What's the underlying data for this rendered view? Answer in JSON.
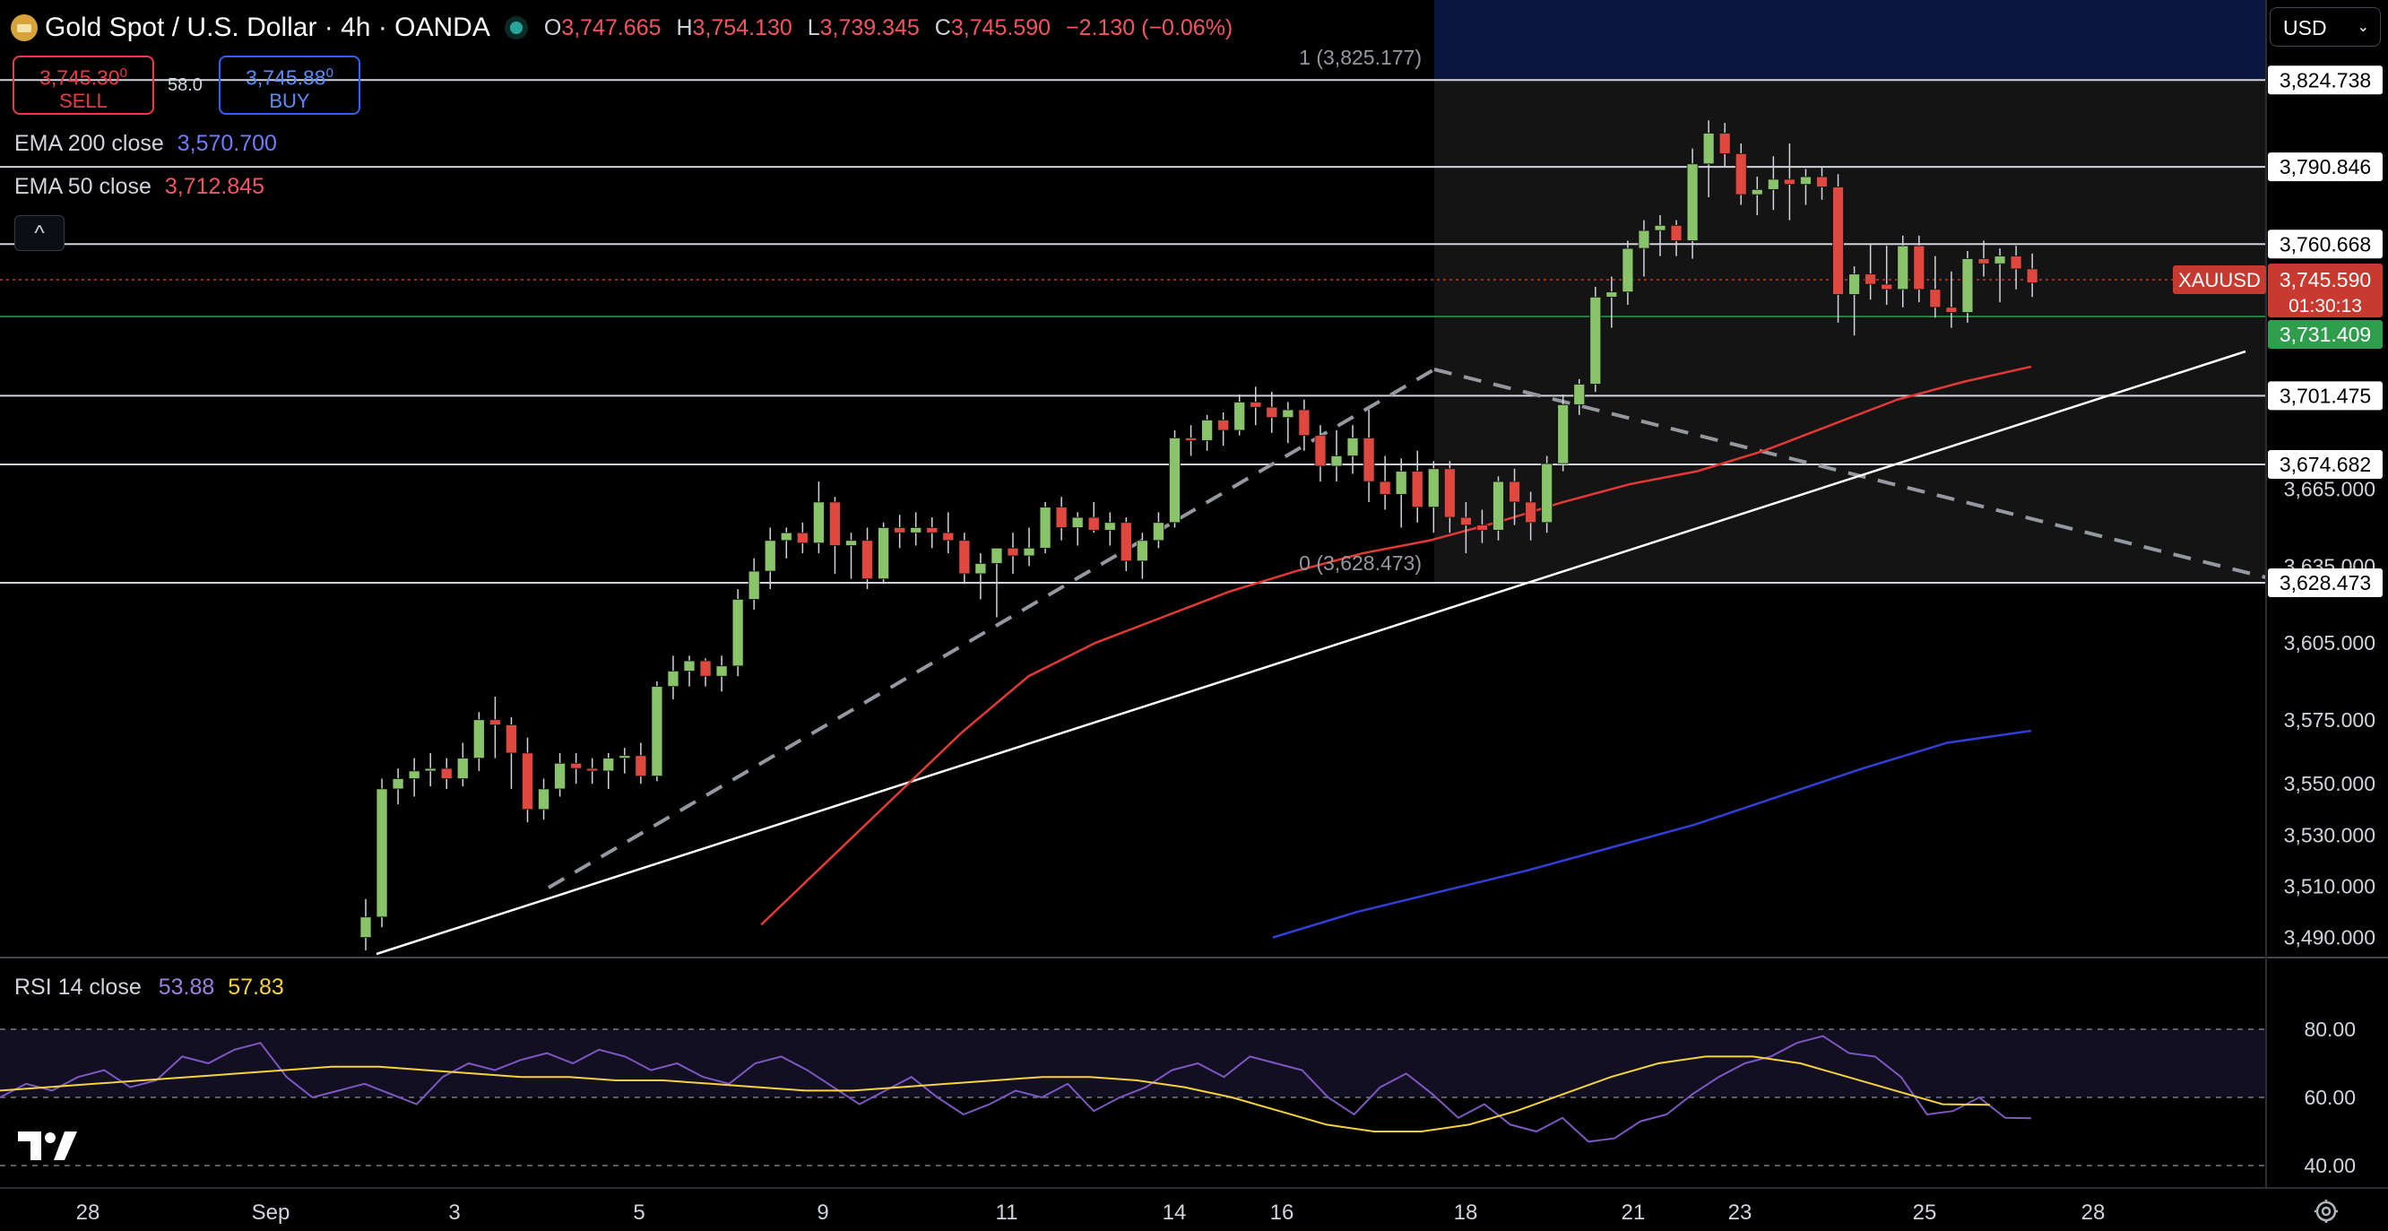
{
  "header": {
    "symbol_title": "Gold Spot / U.S. Dollar · 4h · OANDA",
    "ohlc": {
      "o_label": "O",
      "o": "3,747.665",
      "h_label": "H",
      "h": "3,754.130",
      "l_label": "L",
      "l": "3,739.345",
      "c_label": "C",
      "c": "3,745.590",
      "change": "−2.130 (−0.06%)"
    }
  },
  "trade": {
    "sell_price": "3,745.30",
    "sell_price_sup": "0",
    "sell_label": "SELL",
    "spread": "58.0",
    "buy_price": "3,745.88",
    "buy_price_sup": "0",
    "buy_label": "BUY"
  },
  "indicators": {
    "ema200_label": "EMA 200 close",
    "ema200_value": "3,570.700",
    "ema50_label": "EMA 50 close",
    "ema50_value": "3,712.845",
    "collapse_glyph": "^"
  },
  "currency_selector": {
    "value": "USD",
    "chevron": "⌄"
  },
  "fib": {
    "level_1": "1 (3,825.177)",
    "level_0": "0 (3,628.473)"
  },
  "price_axis": {
    "ticks": [
      "3,665.000",
      "3,635.000",
      "3,605.000",
      "3,575.000",
      "3,550.000",
      "3,530.000",
      "3,510.000",
      "3,490.000"
    ],
    "horizontal_levels": [
      "3,824.738",
      "3,790.846",
      "3,760.668",
      "3,701.475",
      "3,674.682",
      "3,628.473"
    ],
    "current_symbol": "XAUUSD",
    "current_price": "3,745.590",
    "countdown": "01:30:13",
    "green_level": "3,731.409"
  },
  "time_axis": {
    "labels": [
      "28",
      "Sep",
      "3",
      "5",
      "9",
      "11",
      "14",
      "16",
      "18",
      "21",
      "23",
      "25",
      "28"
    ]
  },
  "rsi": {
    "label": "RSI 14 close",
    "value": "53.88",
    "ma_value": "57.83",
    "ticks": [
      "80.00",
      "60.00",
      "40.00"
    ]
  },
  "colors": {
    "bull": "#89c36a",
    "bear": "#e0473e",
    "ema50": "#e53935",
    "ema200": "#3040d8",
    "rsi": "#7e57c2",
    "rsi_ma": "#f5d23e",
    "price_tag": "#c83a2f",
    "green_tag": "#2e9e4d",
    "fib_box": "#1c2a5e"
  },
  "icons": {
    "brand": "tradingview-logo-icon",
    "settings": "settings-gear-icon",
    "gold": "gold-spot-icon"
  },
  "chart_data": {
    "type": "candlestick",
    "symbol": "XAUUSD",
    "timeframe": "4h",
    "ylim": [
      3480,
      3845
    ],
    "indicators": [
      "EMA 200 close",
      "EMA 50 close",
      "RSI 14 close"
    ],
    "candles": [
      [
        3490,
        3505,
        3485,
        3498
      ],
      [
        3498,
        3552,
        3494,
        3548
      ],
      [
        3548,
        3556,
        3542,
        3552
      ],
      [
        3552,
        3560,
        3545,
        3555
      ],
      [
        3555,
        3562,
        3549,
        3556
      ],
      [
        3556,
        3560,
        3548,
        3552
      ],
      [
        3552,
        3566,
        3549,
        3560
      ],
      [
        3560,
        3578,
        3555,
        3575
      ],
      [
        3575,
        3584,
        3560,
        3573
      ],
      [
        3573,
        3576,
        3548,
        3562
      ],
      [
        3562,
        3568,
        3535,
        3540
      ],
      [
        3540,
        3552,
        3536,
        3548
      ],
      [
        3548,
        3562,
        3545,
        3558
      ],
      [
        3558,
        3562,
        3550,
        3556
      ],
      [
        3556,
        3560,
        3550,
        3555
      ],
      [
        3555,
        3562,
        3548,
        3560
      ],
      [
        3560,
        3564,
        3554,
        3561
      ],
      [
        3561,
        3566,
        3550,
        3553
      ],
      [
        3553,
        3590,
        3551,
        3588
      ],
      [
        3588,
        3600,
        3583,
        3594
      ],
      [
        3594,
        3600,
        3588,
        3598
      ],
      [
        3598,
        3599,
        3588,
        3592
      ],
      [
        3592,
        3600,
        3586,
        3596
      ],
      [
        3596,
        3626,
        3592,
        3622
      ],
      [
        3622,
        3638,
        3618,
        3633
      ],
      [
        3633,
        3650,
        3626,
        3645
      ],
      [
        3645,
        3650,
        3638,
        3648
      ],
      [
        3648,
        3652,
        3640,
        3644
      ],
      [
        3644,
        3668,
        3640,
        3660
      ],
      [
        3660,
        3662,
        3632,
        3643
      ],
      [
        3643,
        3648,
        3630,
        3645
      ],
      [
        3645,
        3650,
        3626,
        3630
      ],
      [
        3630,
        3652,
        3628,
        3650
      ],
      [
        3650,
        3655,
        3642,
        3648
      ],
      [
        3648,
        3656,
        3643,
        3650
      ],
      [
        3650,
        3654,
        3642,
        3648
      ],
      [
        3648,
        3656,
        3640,
        3645
      ],
      [
        3645,
        3648,
        3628,
        3632
      ],
      [
        3632,
        3640,
        3622,
        3636
      ],
      [
        3636,
        3642,
        3615,
        3642
      ],
      [
        3642,
        3648,
        3632,
        3639
      ],
      [
        3639,
        3650,
        3635,
        3642
      ],
      [
        3642,
        3660,
        3640,
        3658
      ],
      [
        3658,
        3662,
        3645,
        3650
      ],
      [
        3650,
        3656,
        3643,
        3654
      ],
      [
        3654,
        3660,
        3648,
        3649
      ],
      [
        3649,
        3656,
        3643,
        3652
      ],
      [
        3652,
        3654,
        3633,
        3637
      ],
      [
        3637,
        3648,
        3630,
        3645
      ],
      [
        3645,
        3656,
        3642,
        3652
      ],
      [
        3652,
        3688,
        3650,
        3685
      ],
      [
        3685,
        3690,
        3678,
        3684
      ],
      [
        3684,
        3694,
        3680,
        3692
      ],
      [
        3692,
        3695,
        3682,
        3688
      ],
      [
        3688,
        3702,
        3686,
        3699
      ],
      [
        3699,
        3705,
        3690,
        3697
      ],
      [
        3697,
        3703,
        3687,
        3693
      ],
      [
        3693,
        3699,
        3683,
        3696
      ],
      [
        3696,
        3700,
        3680,
        3686
      ],
      [
        3686,
        3690,
        3668,
        3674
      ],
      [
        3674,
        3688,
        3668,
        3678
      ],
      [
        3678,
        3690,
        3671,
        3685
      ],
      [
        3685,
        3696,
        3660,
        3668
      ],
      [
        3668,
        3678,
        3657,
        3663
      ],
      [
        3663,
        3677,
        3650,
        3672
      ],
      [
        3672,
        3680,
        3652,
        3658
      ],
      [
        3658,
        3676,
        3648,
        3673
      ],
      [
        3673,
        3676,
        3648,
        3654
      ],
      [
        3654,
        3660,
        3640,
        3651
      ],
      [
        3651,
        3657,
        3644,
        3649
      ],
      [
        3649,
        3670,
        3645,
        3668
      ],
      [
        3668,
        3673,
        3651,
        3660
      ],
      [
        3660,
        3664,
        3645,
        3652
      ],
      [
        3652,
        3678,
        3648,
        3675
      ],
      [
        3675,
        3702,
        3672,
        3698
      ],
      [
        3698,
        3708,
        3694,
        3706
      ],
      [
        3706,
        3744,
        3703,
        3740
      ],
      [
        3740,
        3748,
        3728,
        3742
      ],
      [
        3742,
        3762,
        3737,
        3759
      ],
      [
        3759,
        3770,
        3748,
        3766
      ],
      [
        3766,
        3772,
        3756,
        3768
      ],
      [
        3768,
        3770,
        3756,
        3762
      ],
      [
        3762,
        3798,
        3755,
        3792
      ],
      [
        3792,
        3809,
        3779,
        3804
      ],
      [
        3804,
        3808,
        3791,
        3796
      ],
      [
        3796,
        3800,
        3776,
        3780
      ],
      [
        3780,
        3787,
        3772,
        3782
      ],
      [
        3782,
        3795,
        3774,
        3786
      ],
      [
        3786,
        3800,
        3770,
        3784
      ],
      [
        3784,
        3790,
        3776,
        3787
      ],
      [
        3787,
        3791,
        3778,
        3783
      ],
      [
        3783,
        3788,
        3730,
        3741
      ],
      [
        3741,
        3752,
        3725,
        3749
      ],
      [
        3749,
        3761,
        3739,
        3745
      ],
      [
        3745,
        3760,
        3737,
        3743
      ],
      [
        3743,
        3764,
        3736,
        3760
      ],
      [
        3760,
        3764,
        3738,
        3743
      ],
      [
        3743,
        3756,
        3732,
        3736
      ],
      [
        3736,
        3750,
        3728,
        3734
      ],
      [
        3734,
        3758,
        3730,
        3755
      ],
      [
        3755,
        3762,
        3748,
        3753
      ],
      [
        3753,
        3759,
        3738,
        3756
      ],
      [
        3756,
        3760,
        3743,
        3751
      ],
      [
        3751,
        3757,
        3740,
        3745.59
      ]
    ],
    "ema50": [
      3460,
      3475,
      3495,
      3520,
      3545,
      3570,
      3592,
      3605,
      3615,
      3625,
      3633,
      3640,
      3645,
      3652,
      3660,
      3667,
      3672,
      3680,
      3690,
      3700,
      3707,
      3712.845
    ],
    "ema200": [
      3490,
      3500,
      3508,
      3516,
      3525,
      3534,
      3545,
      3556,
      3566,
      3570.7
    ],
    "rsi": [
      60,
      64,
      62,
      66,
      68,
      63,
      65,
      72,
      70,
      74,
      76,
      66,
      60,
      62,
      64,
      61,
      58,
      66,
      70,
      68,
      71,
      73,
      70,
      74,
      72,
      68,
      70,
      66,
      64,
      70,
      72,
      68,
      63,
      58,
      62,
      66,
      60,
      55,
      58,
      62,
      60,
      64,
      56,
      60,
      63,
      68,
      70,
      66,
      72,
      70,
      68,
      60,
      55,
      63,
      67,
      61,
      54,
      58,
      52,
      50,
      54,
      47,
      48,
      53,
      55,
      61,
      66,
      70,
      72,
      76,
      78,
      73,
      72,
      66,
      55,
      56,
      60,
      54,
      53.88
    ],
    "rsi_ma": [
      62,
      63,
      64,
      65,
      66,
      67,
      68,
      69,
      69,
      68,
      67,
      66,
      66,
      65,
      65,
      64,
      63,
      62,
      62,
      63,
      64,
      65,
      66,
      66,
      65,
      63,
      60,
      56,
      52,
      50,
      50,
      52,
      56,
      61,
      66,
      70,
      72,
      72,
      70,
      66,
      62,
      58,
      57.83
    ]
  }
}
